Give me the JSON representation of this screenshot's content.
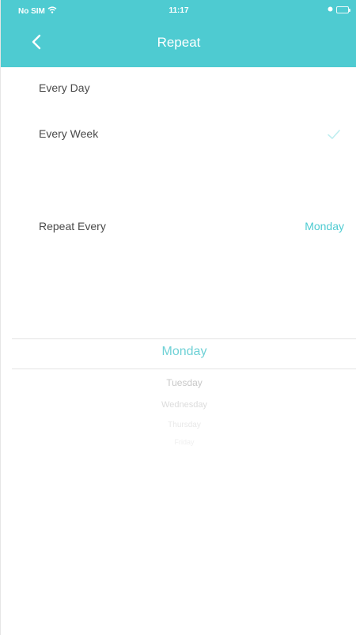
{
  "status_bar": {
    "carrier": "No SIM",
    "time": "11:17"
  },
  "nav": {
    "title": "Repeat",
    "back_icon": "chevron-left-icon"
  },
  "options": [
    {
      "label": "Every Day",
      "selected": false
    },
    {
      "label": "Every Week",
      "selected": true
    }
  ],
  "repeat": {
    "label": "Repeat Every",
    "value": "Monday"
  },
  "picker": {
    "selected": "Monday",
    "next": [
      "Tuesday",
      "Wednesday",
      "Thursday",
      "Friday"
    ]
  },
  "colors": {
    "accent": "#4ecbd1",
    "text": "#4a4a4a",
    "divider": "#e3e3e3"
  }
}
